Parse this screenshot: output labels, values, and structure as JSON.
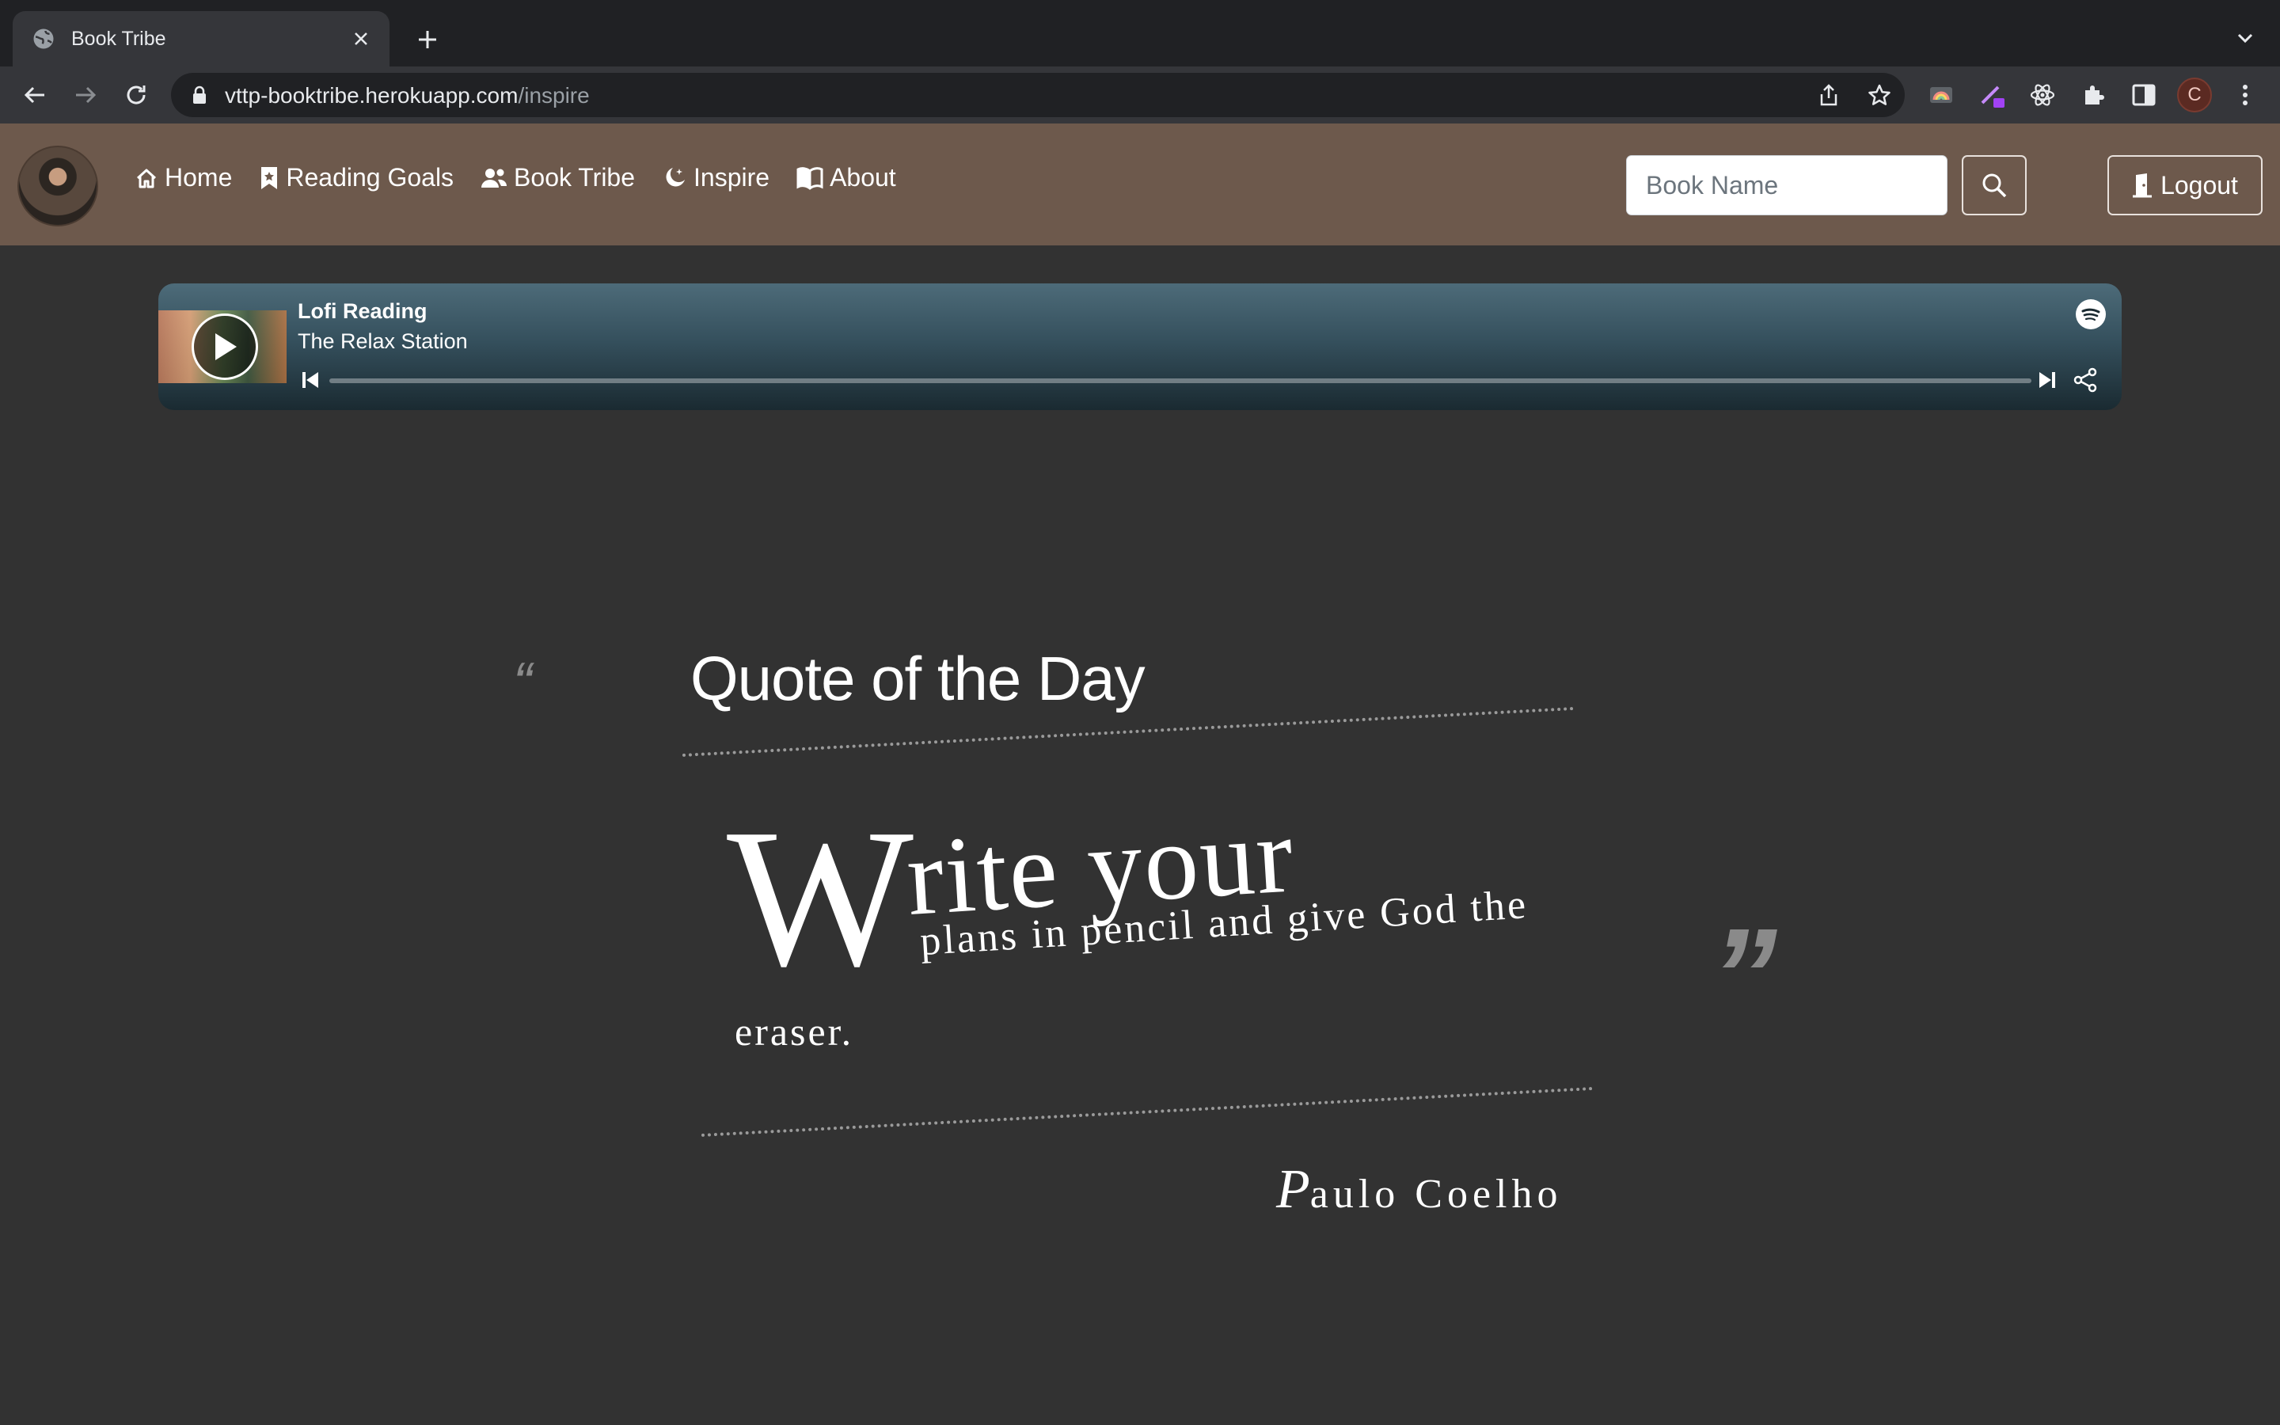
{
  "browser": {
    "tab_title": "Book Tribe",
    "url_host": "vttp-booktribe.herokuapp.com",
    "url_path": "/inspire",
    "profile_initial": "C"
  },
  "navbar": {
    "links": [
      {
        "label": "Home",
        "icon": "house-icon"
      },
      {
        "label": "Reading Goals",
        "icon": "bookmark-icon"
      },
      {
        "label": "Book Tribe",
        "icon": "people-icon"
      },
      {
        "label": "Inspire",
        "icon": "moon-stars-icon"
      },
      {
        "label": "About",
        "icon": "book-open-icon"
      }
    ],
    "search_placeholder": "Book Name",
    "logout_label": "Logout"
  },
  "player": {
    "track_title": "Lofi Reading",
    "track_artist": "The Relax Station",
    "progress": 0
  },
  "quote": {
    "heading": "Quote of the Day",
    "open_mark": "“",
    "close_mark": "”",
    "first_letter": "W",
    "line1_rest": "rite your",
    "line2": "plans in pencil and give God the",
    "line3": "eraser.",
    "author_initial": "P",
    "author_rest": "aulo Coelho"
  },
  "colors": {
    "page_bg": "#323232",
    "navbar_bg": "#6d594c",
    "player_gradient_top": "#4d6b79",
    "player_gradient_bottom": "#1a2a31"
  }
}
